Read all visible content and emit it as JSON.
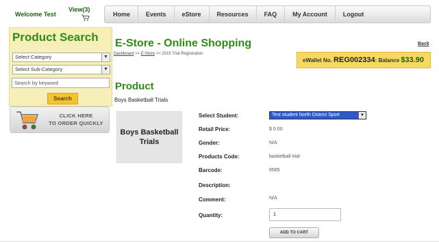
{
  "header": {
    "welcome": "Welcome Test",
    "view_cart": "View(3)"
  },
  "nav": {
    "items": [
      "Home",
      "Events",
      "eStore",
      "Resources",
      "FAQ",
      "My Account",
      "Logout"
    ]
  },
  "sidebar": {
    "title": "Product Search",
    "category_select": "Select Category",
    "subcategory_select": "Select Sub-Category",
    "keyword_placeholder": "Search by keyword",
    "search_button": "Search",
    "order_quick_line1": "Click here",
    "order_quick_line2": "to order quickly"
  },
  "main": {
    "title": "E-Store - Online Shopping",
    "breadcrumb": {
      "home": "Dashboard",
      "sep1": " >> ",
      "store": "E-Store",
      "sep2": " >> ",
      "current": "2015 Trial Registration"
    },
    "back": "Back",
    "wallet": {
      "label": "eWallet No. ",
      "number": "REG002334",
      "balance_label": ": Balance ",
      "balance": "$33.90"
    },
    "section_title": "Product",
    "product_name": "Boys Basketball Trials",
    "image_text_1": "Boys Basketball",
    "image_text_2": "Trials"
  },
  "details": {
    "select_student_label": "Select Student:",
    "student_value": "Test student North District Sport",
    "retail_price_label": "Retail Price:",
    "retail_price": "$ 0.00",
    "gender_label": "Gender:",
    "gender": "N/A",
    "product_code_label": "Products Code:",
    "product_code": "basketball trial",
    "barcode_label": "Barcode:",
    "barcode": "6565",
    "description_label": "Description:",
    "comment_label": "Comment:",
    "comment": "N/A",
    "quantity_label": "Quantity:",
    "quantity": "1",
    "add_to_cart": "ADD TO CART"
  },
  "colors": {
    "accent_green": "#2e8b18",
    "sidebar_bg": "#f7efb8",
    "wallet_bg": "#f7d960",
    "select_highlight": "#2f59c8"
  }
}
